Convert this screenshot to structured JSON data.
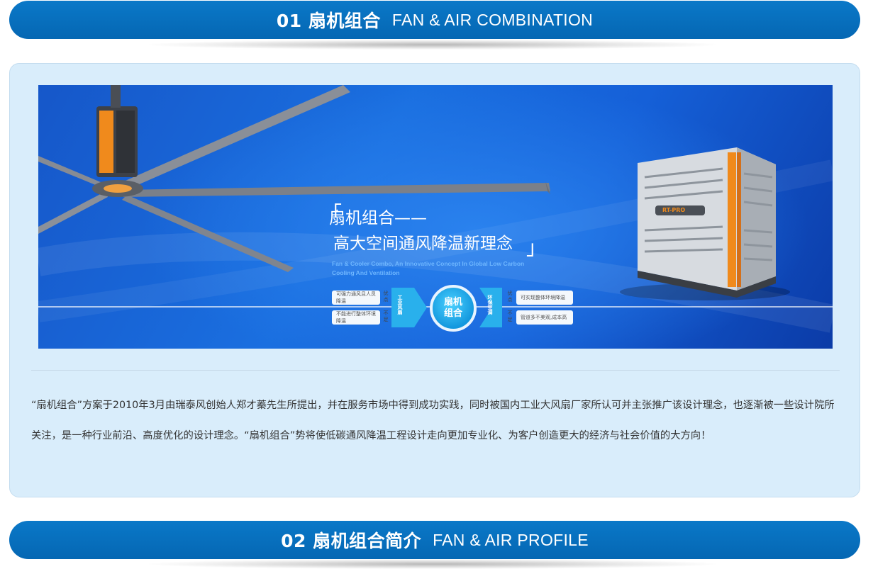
{
  "sections": [
    {
      "title_cn": "01 扇机组合",
      "title_en": "FAN & AIR COMBINATION"
    },
    {
      "title_cn": "02 扇机组合简介",
      "title_en": "FAN & AIR PROFILE"
    }
  ],
  "banner": {
    "slogan_line1": "扇机组合——",
    "slogan_line2": "高大空间通风降温新理念",
    "bracket_left": "「",
    "bracket_right": "」",
    "slogan_en_line1": "Fan & Cooler Combo, An Innovative Concept In Global Low Carbon",
    "slogan_en_line2": "Cooling And Ventilation",
    "left_pill_top": "可强力通风且人员降温",
    "left_pill_bottom": "不能进行整体环境降温",
    "left_tag_top": "优点",
    "left_tag_bottom": "不足",
    "left_arrow": "工业风扇",
    "center_line1": "扇机",
    "center_line2": "组合",
    "right_arrow": "环保空调",
    "right_tag_top": "优点",
    "right_tag_bottom": "不足",
    "right_pill_top": "可实现整体环境降温",
    "right_pill_bottom": "管道多不美观,成本高",
    "cooler_brand": "RT-PRO"
  },
  "description": "“扇机组合”方案于2010年3月由瑞泰风创始人郑才蓁先生所提出，并在服务市场中得到成功实践，同时被国内工业大风扇厂家所认可并主张推广该设计理念，也逐渐被一些设计院所关注，是一种行业前沿、高度优化的设计理念。“扇机组合”势将使低碳通风降温工程设计走向更加专业化、为客户创造更大的经济与社会价值的大方向！",
  "colors": {
    "bar_blue": "#0a6fc0",
    "card_bg": "#d9edfb",
    "banner_blue": "#1a6fe0",
    "accent_orange": "#f08a1c"
  }
}
